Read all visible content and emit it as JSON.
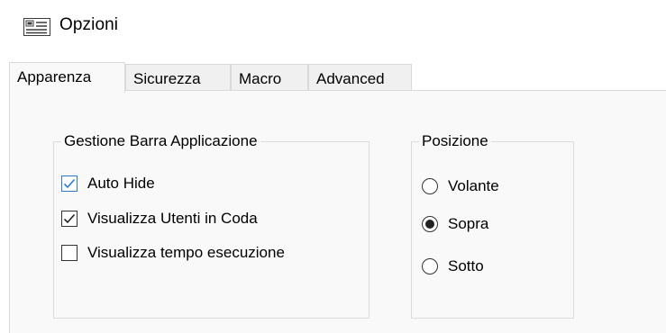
{
  "window": {
    "title": "Opzioni",
    "icon": "properties-window-icon"
  },
  "tabs": [
    {
      "label": "Apparenza",
      "active": true
    },
    {
      "label": "Sicurezza",
      "active": false
    },
    {
      "label": "Macro",
      "active": false
    },
    {
      "label": "Advanced",
      "active": false
    }
  ],
  "taskbar_group": {
    "legend": "Gestione Barra Applicazione",
    "options": [
      {
        "label": "Auto Hide",
        "checked": true
      },
      {
        "label": "Visualizza Utenti in Coda",
        "checked": true
      },
      {
        "label": "Visualizza tempo esecuzione",
        "checked": false
      }
    ]
  },
  "position_group": {
    "legend": "Posizione",
    "options": [
      {
        "label": "Volante",
        "selected": false
      },
      {
        "label": "Sopra",
        "selected": true
      },
      {
        "label": "Sotto",
        "selected": false
      }
    ]
  },
  "colors": {
    "focus_accent": "#2a7ad3",
    "panel_background": "#f9f9f9",
    "tab_background": "#f0f0f0",
    "border": "#d9d9d9"
  }
}
